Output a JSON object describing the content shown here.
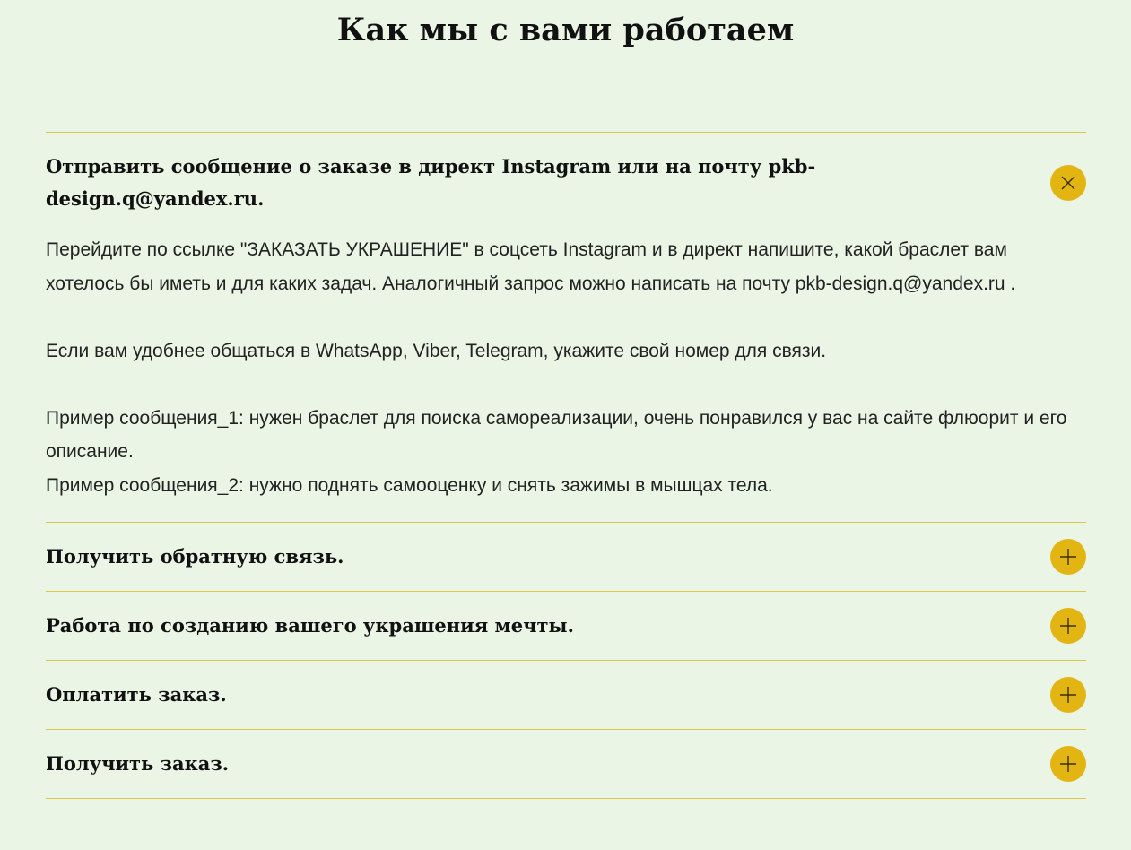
{
  "page": {
    "title": "Как мы с вами работаем"
  },
  "accordion": {
    "items": [
      {
        "title": "Отправить сообщение о заказе в директ Instagram или на почту pkb-design.q@yandex.ru.",
        "state": "open",
        "toggle_icon": "close-icon",
        "body": {
          "p1": "Перейдите по ссылке \"ЗАКАЗАТЬ УКРАШЕНИЕ\" в соцсеть Instagram и в директ напишите, какой браслет вам хотелось бы иметь и для каких задач. Аналогичный запрос можно написать на почту pkb-design.q@yandex.ru .",
          "p2": "Если вам удобнее общаться в WhatsApp, Viber, Telegram, укажите свой номер для связи.",
          "p3": "Пример сообщения_1: нужен браслет для поиска самореализации, очень понравился у вас на сайте флюорит и его описание.",
          "p4": "Пример сообщения_2: нужно поднять самооценку и снять зажимы в мышцах тела."
        }
      },
      {
        "title": "Получить обратную связь.",
        "state": "closed",
        "toggle_icon": "plus-icon"
      },
      {
        "title": "Работа по созданию вашего украшения мечты.",
        "state": "closed",
        "toggle_icon": "plus-icon"
      },
      {
        "title": "Оплатить заказ.",
        "state": "closed",
        "toggle_icon": "plus-icon"
      },
      {
        "title": "Получить заказ.",
        "state": "closed",
        "toggle_icon": "plus-icon"
      }
    ]
  },
  "colors": {
    "background": "#eaf5e6",
    "accent": "#e3b512",
    "divider": "#dcc84a",
    "text": "#111111"
  }
}
